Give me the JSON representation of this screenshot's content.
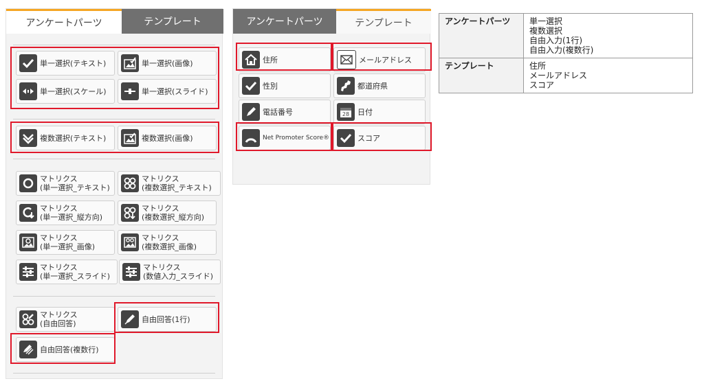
{
  "left_panel": {
    "tabs": [
      {
        "label": "アンケートパーツ"
      },
      {
        "label": "テンプレート"
      }
    ],
    "single": [
      {
        "label": "単一選択(テキスト)",
        "icon": "check-icon"
      },
      {
        "label": "単一選択(画像)",
        "icon": "image-check-icon"
      },
      {
        "label": "単一選択(スケール)",
        "icon": "scale-icon"
      },
      {
        "label": "単一選択(スライド)",
        "icon": "slider-icon"
      }
    ],
    "multi": [
      {
        "label": "複数選択(テキスト)",
        "icon": "double-check-icon"
      },
      {
        "label": "複数選択(画像)",
        "icon": "image-check-icon"
      }
    ],
    "matrix": [
      {
        "l1": "マトリクス",
        "l2": "(単一選択_テキスト)",
        "icon": "circle-icon"
      },
      {
        "l1": "マトリクス",
        "l2": "(複数選択_テキスト)",
        "icon": "circles-icon"
      },
      {
        "l1": "マトリクス",
        "l2": "(単一選択_縦方向)",
        "icon": "circle-vertical-icon"
      },
      {
        "l1": "マトリクス",
        "l2": "(複数選択_縦方向)",
        "icon": "circles-vertical-icon"
      },
      {
        "l1": "マトリクス",
        "l2": "(単一選択_画像)",
        "icon": "image-circle-icon"
      },
      {
        "l1": "マトリクス",
        "l2": "(複数選択_画像)",
        "icon": "image-circles-icon"
      },
      {
        "l1": "マトリクス",
        "l2": "(単一選択_スライド)",
        "icon": "sliders-icon"
      },
      {
        "l1": "マトリクス",
        "l2": "(数値入力_スライド)",
        "icon": "sliders-icon"
      }
    ],
    "free": [
      {
        "l1": "マトリクス",
        "l2": "(自由回答)",
        "icon": "pen-circles-icon"
      },
      {
        "label": "自由回答(1行)",
        "icon": "pen-icon"
      },
      {
        "label": "自由回答(複数行)",
        "icon": "pen-lines-icon"
      }
    ]
  },
  "mid_panel": {
    "tabs": [
      {
        "label": "アンケートパーツ"
      },
      {
        "label": "テンプレート"
      }
    ],
    "items": [
      {
        "label": "住所",
        "icon": "home-icon"
      },
      {
        "label": "メールアドレス",
        "icon": "mail-icon"
      },
      {
        "label": "性別",
        "icon": "check-icon"
      },
      {
        "label": "都道府県",
        "icon": "map-icon"
      },
      {
        "label": "電話番号",
        "icon": "pen-icon"
      },
      {
        "label": "日付",
        "icon": "calendar-icon"
      },
      {
        "label": "Net Promoter Score®",
        "icon": "gauge-icon"
      },
      {
        "label": "スコア",
        "icon": "check-icon"
      }
    ],
    "calendar_day": "28"
  },
  "table": {
    "rows": [
      {
        "head": "アンケートパーツ",
        "items": [
          "単一選択",
          "複数選択",
          "自由入力(1行)",
          "自由入力(複数行)"
        ]
      },
      {
        "head": "テンプレート",
        "items": [
          "住所",
          "メールアドレス",
          "スコア"
        ]
      }
    ]
  },
  "colors": {
    "highlight": "#e0182a",
    "tab_accent": "#f5a623",
    "icon_bg": "#444444"
  }
}
